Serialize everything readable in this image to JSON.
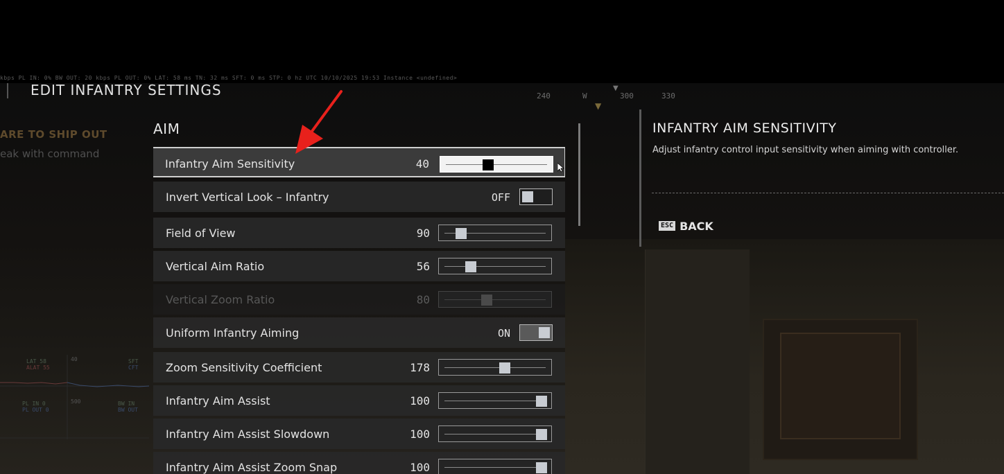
{
  "hud": {
    "stats_line": "kbps  PL IN:  0%   BW OUT:  20 kbps   PL OUT:  0%   LAT:  58 ms   TN:  32 ms   SFT:  0 ms   STP:  0 hz   UTC 10/10/2025 19:53   Instance  <undefined>",
    "compass": [
      "240",
      "W",
      "300",
      "330"
    ]
  },
  "background_text": {
    "hint_line1": "ARE TO SHIP OUT",
    "hint_line2": "eak with command"
  },
  "graph_panel": {
    "lat_label": "LAT  58",
    "alat_label": "ALAT 55",
    "top_scale": "40",
    "sft_label": "SFT",
    "cft_label": "CFT",
    "bottom_scale": "500",
    "plin_label": "PL IN   0",
    "plout_label": "PL OUT  0",
    "bwin_label": "BW IN",
    "bwout_label": "BW OUT"
  },
  "page": {
    "title": "EDIT INFANTRY SETTINGS",
    "section": "AIM"
  },
  "settings": [
    {
      "label": "Infantry Aim Sensitivity",
      "value": "40",
      "control": "slider",
      "level": 0.4,
      "selected": true,
      "disabled": false
    },
    {
      "label": "Invert Vertical Look – Infantry",
      "value": "OFF",
      "control": "toggle",
      "state": "off",
      "selected": false,
      "disabled": false
    },
    {
      "label": "Field of View",
      "value": "90",
      "control": "slider",
      "level": 0.12,
      "selected": false,
      "disabled": false
    },
    {
      "label": "Vertical Aim Ratio",
      "value": "56",
      "control": "slider",
      "level": 0.23,
      "selected": false,
      "disabled": false
    },
    {
      "label": "Vertical Zoom Ratio",
      "value": "80",
      "control": "slider",
      "level": 0.4,
      "selected": false,
      "disabled": true
    },
    {
      "label": "Uniform Infantry Aiming",
      "value": "ON",
      "control": "toggle",
      "state": "on",
      "selected": false,
      "disabled": false
    },
    {
      "label": "Zoom Sensitivity Coefficient",
      "value": "178",
      "control": "slider",
      "level": 0.6,
      "selected": false,
      "disabled": false
    },
    {
      "label": "Infantry Aim Assist",
      "value": "100",
      "control": "slider",
      "level": 1.0,
      "selected": false,
      "disabled": false
    },
    {
      "label": "Infantry Aim Assist Slowdown",
      "value": "100",
      "control": "slider",
      "level": 1.0,
      "selected": false,
      "disabled": false
    },
    {
      "label": "Infantry Aim Assist Zoom Snap",
      "value": "100",
      "control": "slider",
      "level": 1.0,
      "selected": false,
      "disabled": false
    }
  ],
  "info": {
    "title": "INFANTRY AIM SENSITIVITY",
    "description": "Adjust infantry control input sensitivity when aiming with controller.",
    "back_key": "ESC",
    "back_label": "BACK"
  },
  "colors": {
    "annotation_arrow": "#e8211c",
    "selected_border": "#cfcfcf",
    "row_background": "#282828"
  }
}
